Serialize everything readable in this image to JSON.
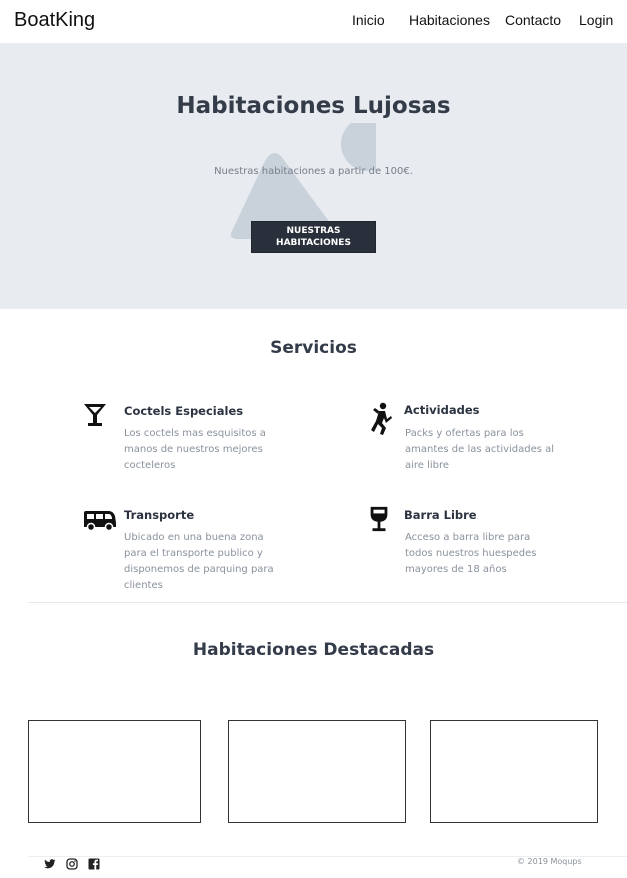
{
  "nav": {
    "brand": "BoatKing",
    "links": [
      "Inicio",
      "Habitaciones",
      "Contacto",
      "Login"
    ]
  },
  "hero": {
    "title": "Habitaciones Lujosas",
    "subtitle": "Nuestras habitaciones a partir de 100€.",
    "button_line1": "NUESTRAS",
    "button_line2": "HABITACIONES"
  },
  "services": {
    "title": "Servicios",
    "items": [
      {
        "icon": "cocktail-icon",
        "title": "Coctels Especiales",
        "lines": [
          "Los coctels mas esquisitos a",
          "manos de nuestros mejores",
          "cocteleros"
        ]
      },
      {
        "icon": "activity-icon",
        "title": "Actividades",
        "lines": [
          "Packs y ofertas para los",
          "amantes de las actividades al",
          "aire libre"
        ]
      },
      {
        "icon": "van-icon",
        "title": "Transporte",
        "lines": [
          "Ubicado en una buena zona",
          "para el transporte publico y",
          "disponemos de parquing para",
          "clientes"
        ]
      },
      {
        "icon": "wine-glass-icon",
        "title": "Barra Libre",
        "lines": [
          "Acceso a barra libre para",
          "todos nuestros huespedes",
          "mayores de 18 años"
        ]
      }
    ]
  },
  "featured": {
    "title": "Habitaciones Destacadas"
  },
  "footer": {
    "icons": [
      "twitter-icon",
      "instagram-icon",
      "facebook-icon"
    ],
    "copyright": "© 2019  Moqups"
  },
  "colors": {
    "hero_bg": "#e8ebef",
    "heading": "#343c4a",
    "button_bg": "#2a303b",
    "muted_text": "#8a929c"
  }
}
